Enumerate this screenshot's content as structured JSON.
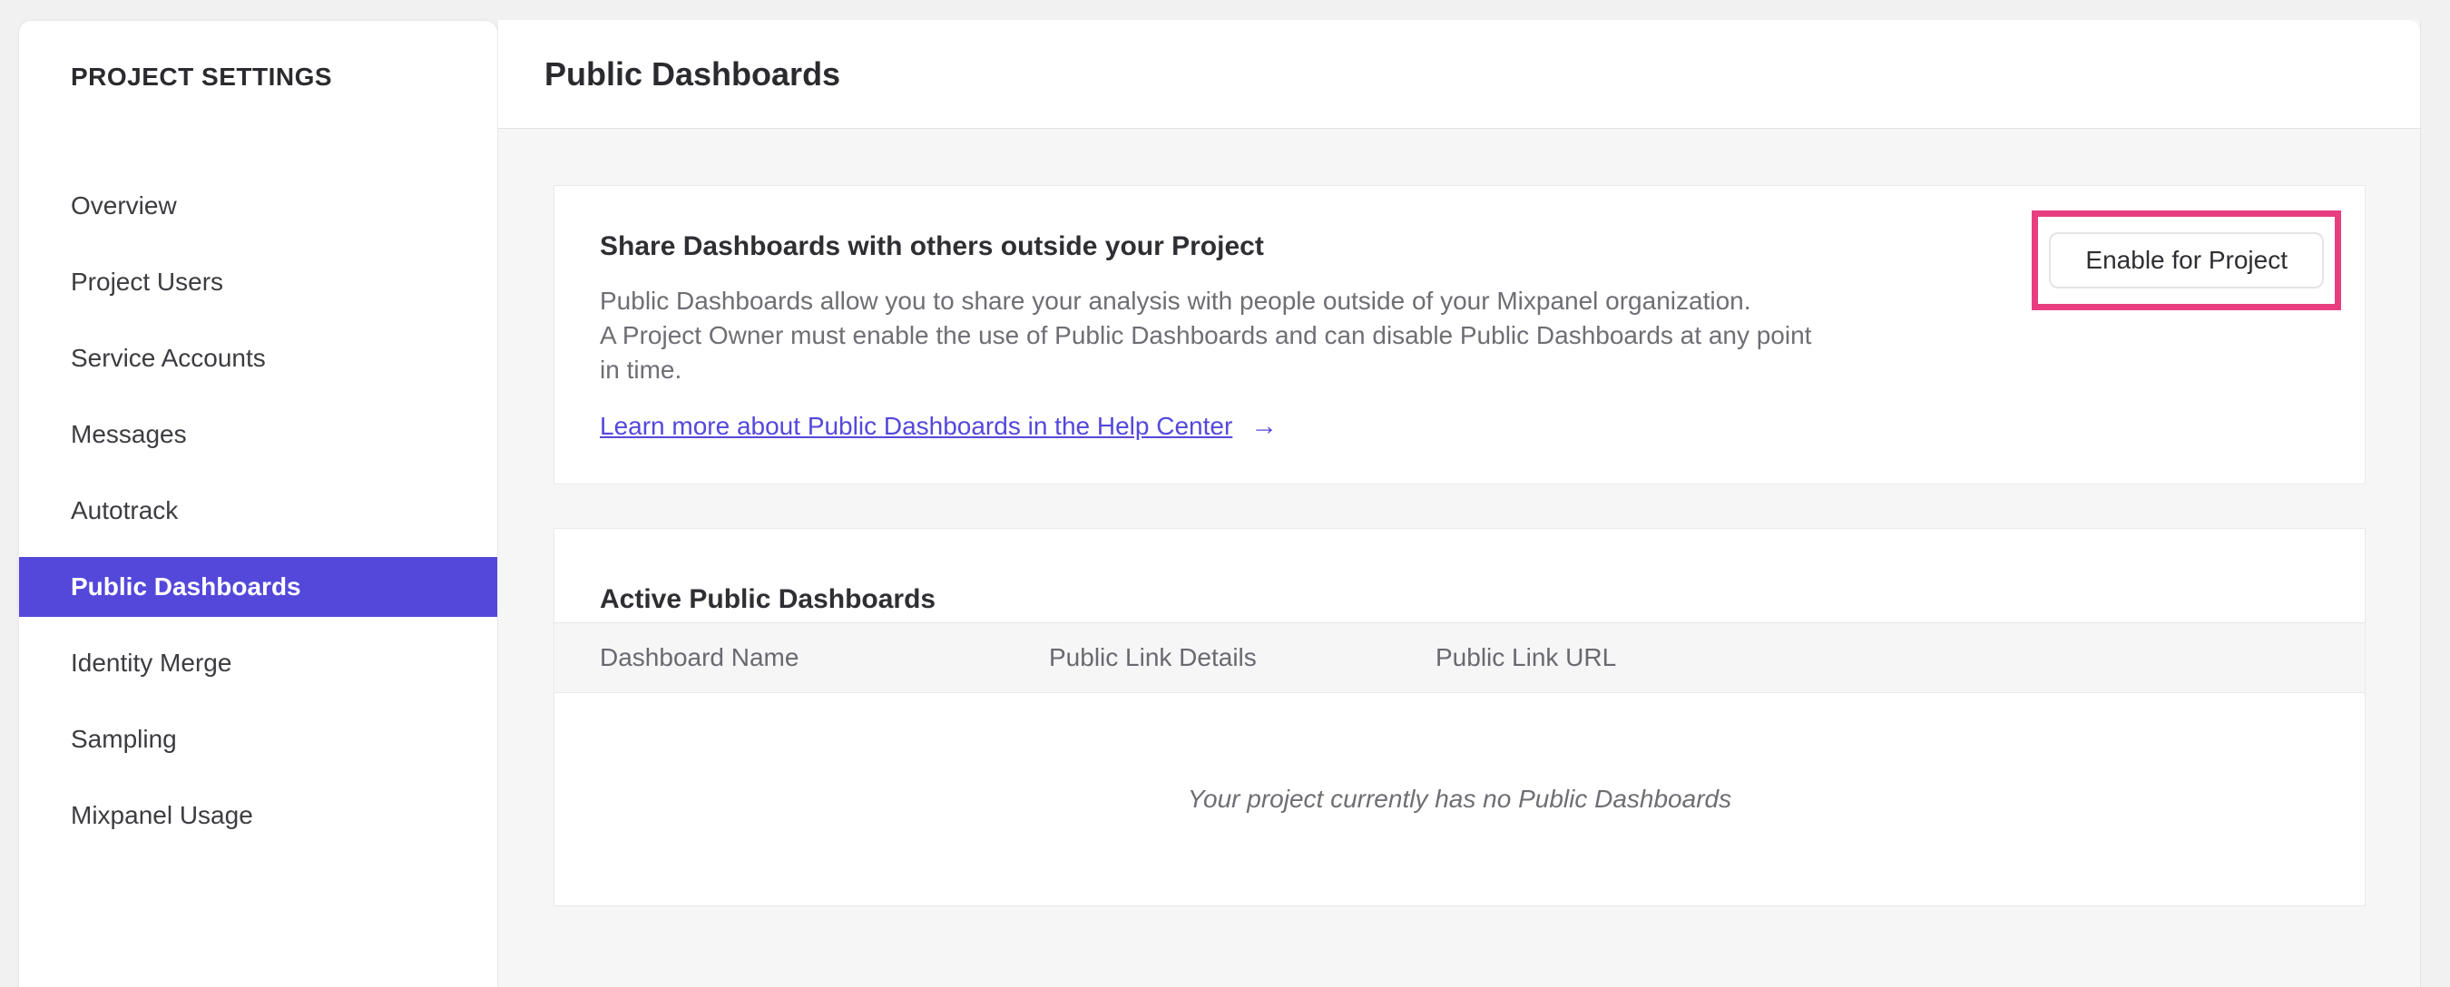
{
  "sidebar": {
    "title": "PROJECT SETTINGS",
    "items": [
      {
        "label": "Overview"
      },
      {
        "label": "Project Users"
      },
      {
        "label": "Service Accounts"
      },
      {
        "label": "Messages"
      },
      {
        "label": "Autotrack"
      },
      {
        "label": "Public Dashboards",
        "selected": true
      },
      {
        "label": "Identity Merge"
      },
      {
        "label": "Sampling"
      },
      {
        "label": "Mixpanel Usage"
      }
    ]
  },
  "header": {
    "title": "Public Dashboards"
  },
  "share_card": {
    "title": "Share Dashboards with others outside your Project",
    "description": "Public Dashboards allow you to share your analysis with people outside of your Mixpanel organization.\nA Project Owner must enable the use of Public Dashboards and can disable Public Dashboards at any point\nin time.",
    "link_label": "Learn more about Public Dashboards in the Help Center",
    "link_arrow": "→",
    "button_label": "Enable for Project"
  },
  "active_card": {
    "title": "Active Public Dashboards",
    "columns": [
      "Dashboard Name",
      "Public Link Details",
      "Public Link URL"
    ],
    "empty_message": "Your project currently has no Public Dashboards"
  },
  "colors": {
    "brand_purple": "#5448DB",
    "highlight_pink": "#E83E80",
    "panel_background": "#f6f6f7"
  }
}
